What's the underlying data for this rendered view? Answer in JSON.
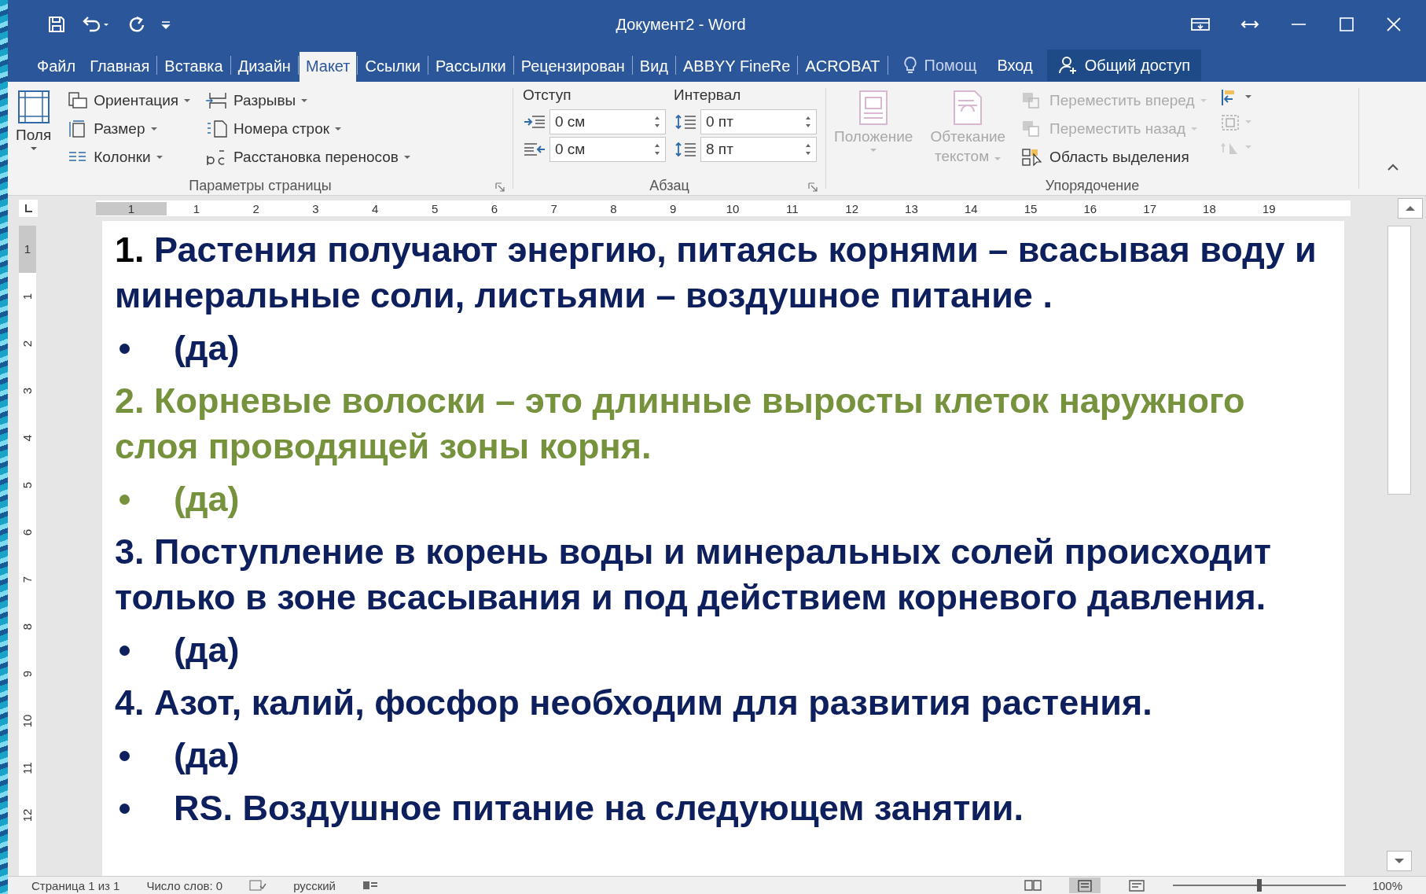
{
  "window": {
    "title": "Документ2 - Word"
  },
  "tabs": [
    {
      "label": "Файл",
      "selected": false
    },
    {
      "label": "Главная",
      "selected": false
    },
    {
      "label": "Вставка",
      "selected": false
    },
    {
      "label": "Дизайн",
      "selected": false
    },
    {
      "label": "Макет",
      "selected": true
    },
    {
      "label": "Ссылки",
      "selected": false
    },
    {
      "label": "Рассылки",
      "selected": false
    },
    {
      "label": "Рецензирован",
      "selected": false
    },
    {
      "label": "Вид",
      "selected": false
    },
    {
      "label": "ABBYY FineRe",
      "selected": false
    },
    {
      "label": "ACROBAT",
      "selected": false
    }
  ],
  "tell_me": "Помощ",
  "sign_in": "Вход",
  "share": "Общий доступ",
  "ribbon": {
    "page_setup": {
      "label": "Параметры страницы",
      "margins": "Поля",
      "column_1": [
        {
          "label": "Ориентация",
          "kind": "orientation"
        },
        {
          "label": "Размер",
          "kind": "size"
        },
        {
          "label": "Колонки",
          "kind": "columns"
        }
      ],
      "column_2": [
        {
          "label": "Разрывы",
          "kind": "breaks"
        },
        {
          "label": "Номера строк",
          "kind": "line-numbers"
        },
        {
          "label": "Расстановка переносов",
          "kind": "hyphenation"
        }
      ]
    },
    "paragraph": {
      "label": "Абзац",
      "indent_label": "Отступ",
      "spacing_label": "Интервал",
      "indent_left": "0 см",
      "indent_right": "0 см",
      "spacing_before": "0 пт",
      "spacing_after": "8 пт"
    },
    "arrange": {
      "label": "Упорядочение",
      "position": "Положение",
      "wrap_text": [
        "Обтекание",
        "текстом"
      ],
      "commands": [
        {
          "label": "Переместить вперед",
          "kind": "forward",
          "disabled": true
        },
        {
          "label": "Переместить назад",
          "kind": "backward",
          "disabled": true
        },
        {
          "label": "Область выделения",
          "kind": "selection-pane",
          "disabled": false
        }
      ]
    }
  },
  "ruler": {
    "horizontal": [
      "1",
      "1",
      "2",
      "3",
      "4",
      "5",
      "6",
      "7",
      "8",
      "9",
      "10",
      "11",
      "12",
      "13",
      "14",
      "15",
      "16",
      "17",
      "18",
      "19"
    ],
    "vertical": [
      "1",
      "1",
      "2",
      "3",
      "4",
      "5",
      "6",
      "7",
      "8",
      "9",
      "10",
      "11",
      "12"
    ]
  },
  "document": [
    {
      "kind": "question",
      "number": {
        "text": "1.",
        "color": "#000000"
      },
      "text": "Растения получают энергию, питаясь корнями –  всасывая воду и минеральные соли, листьями – воздушное питание .",
      "color": "#0d1f5c"
    },
    {
      "kind": "bullet",
      "text": "(да)",
      "color": "#0d1f5c"
    },
    {
      "kind": "question",
      "number": {
        "text": "2.",
        "color": "#76923c"
      },
      "text": "Корневые волоски – это длинные выросты клеток наружного слоя проводящей зоны корня.",
      "color": "#76923c"
    },
    {
      "kind": "bullet",
      "text": "(да)",
      "color": "#76923c"
    },
    {
      "kind": "question",
      "number": {
        "text": "3.",
        "color": "#0d1f5c"
      },
      "text": "Поступление в корень воды и минеральных солей происходит только в зоне всасывания и под действием корневого давления.",
      "color": "#0d1f5c"
    },
    {
      "kind": "bullet",
      "text": "(да)",
      "color": "#0d1f5c"
    },
    {
      "kind": "question",
      "number": {
        "text": "4.",
        "color": "#0d1f5c"
      },
      "text": "Азот, калий, фосфор необходим для развития растения.",
      "color": "#0d1f5c"
    },
    {
      "kind": "bullet",
      "text": "(да)",
      "color": "#0d1f5c"
    },
    {
      "kind": "bullet",
      "text": "RS. Воздушное питание на следующем занятии.",
      "color": "#0d1f5c"
    }
  ],
  "status_bar": {
    "page": "Страница 1 из 1",
    "words": "Число слов: 0",
    "language": "русский",
    "zoom": "100%",
    "zoom_slider": {
      "level": 0.5
    }
  }
}
